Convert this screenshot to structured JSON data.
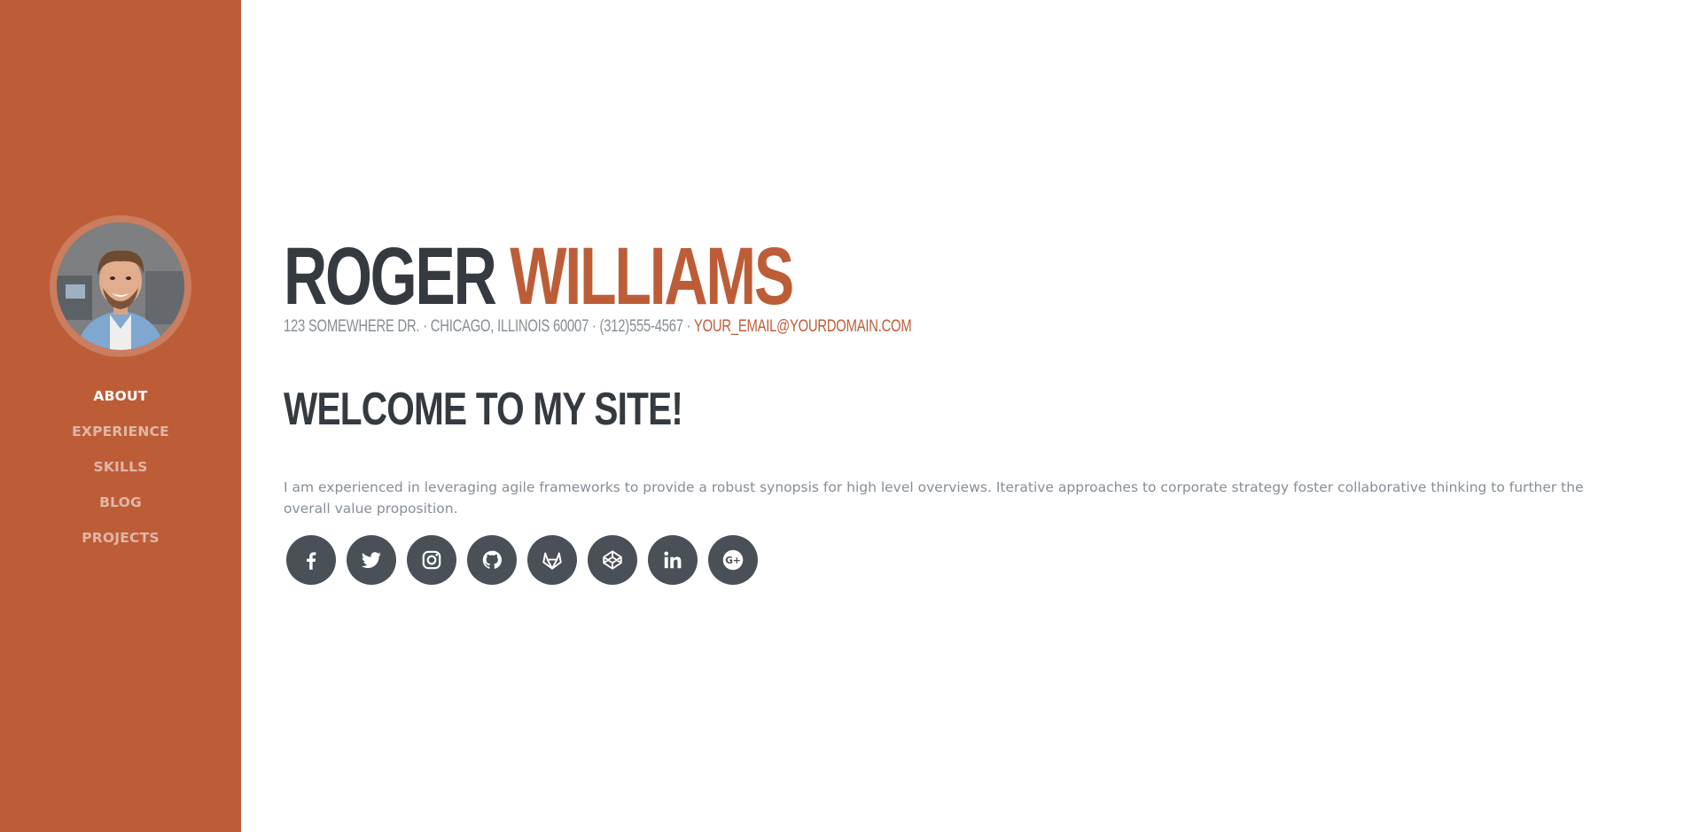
{
  "sidebar": {
    "avatar_alt": "profile photo",
    "nav": [
      {
        "label": "About",
        "active": true
      },
      {
        "label": "Experience",
        "active": false
      },
      {
        "label": "Skills",
        "active": false
      },
      {
        "label": "Blog",
        "active": false
      },
      {
        "label": "Projects",
        "active": false
      }
    ]
  },
  "header": {
    "first_name": "ROGER",
    "last_name": "WILLIAMS",
    "address": "123 SOMEWHERE DR. · CHICAGO, ILLINOIS 60007 · (312)555-4567 · ",
    "email": "YOUR_EMAIL@YOURDOMAIN.COM"
  },
  "main": {
    "welcome": "WELCOME TO MY SITE!",
    "lead": "I am experienced in leveraging agile frameworks to provide a robust synopsis for high level overviews. Iterative approaches to corporate strategy foster collaborative thinking to further the overall value proposition."
  },
  "social": [
    {
      "icon": "facebook-icon"
    },
    {
      "icon": "twitter-icon"
    },
    {
      "icon": "instagram-icon"
    },
    {
      "icon": "github-icon"
    },
    {
      "icon": "gitlab-icon"
    },
    {
      "icon": "codepen-icon"
    },
    {
      "icon": "linkedin-icon"
    },
    {
      "icon": "google-plus-icon"
    }
  ],
  "colors": {
    "brand": "#bd5d38",
    "dark": "#343a40",
    "muted": "#868e96",
    "social_bg": "#495057"
  }
}
